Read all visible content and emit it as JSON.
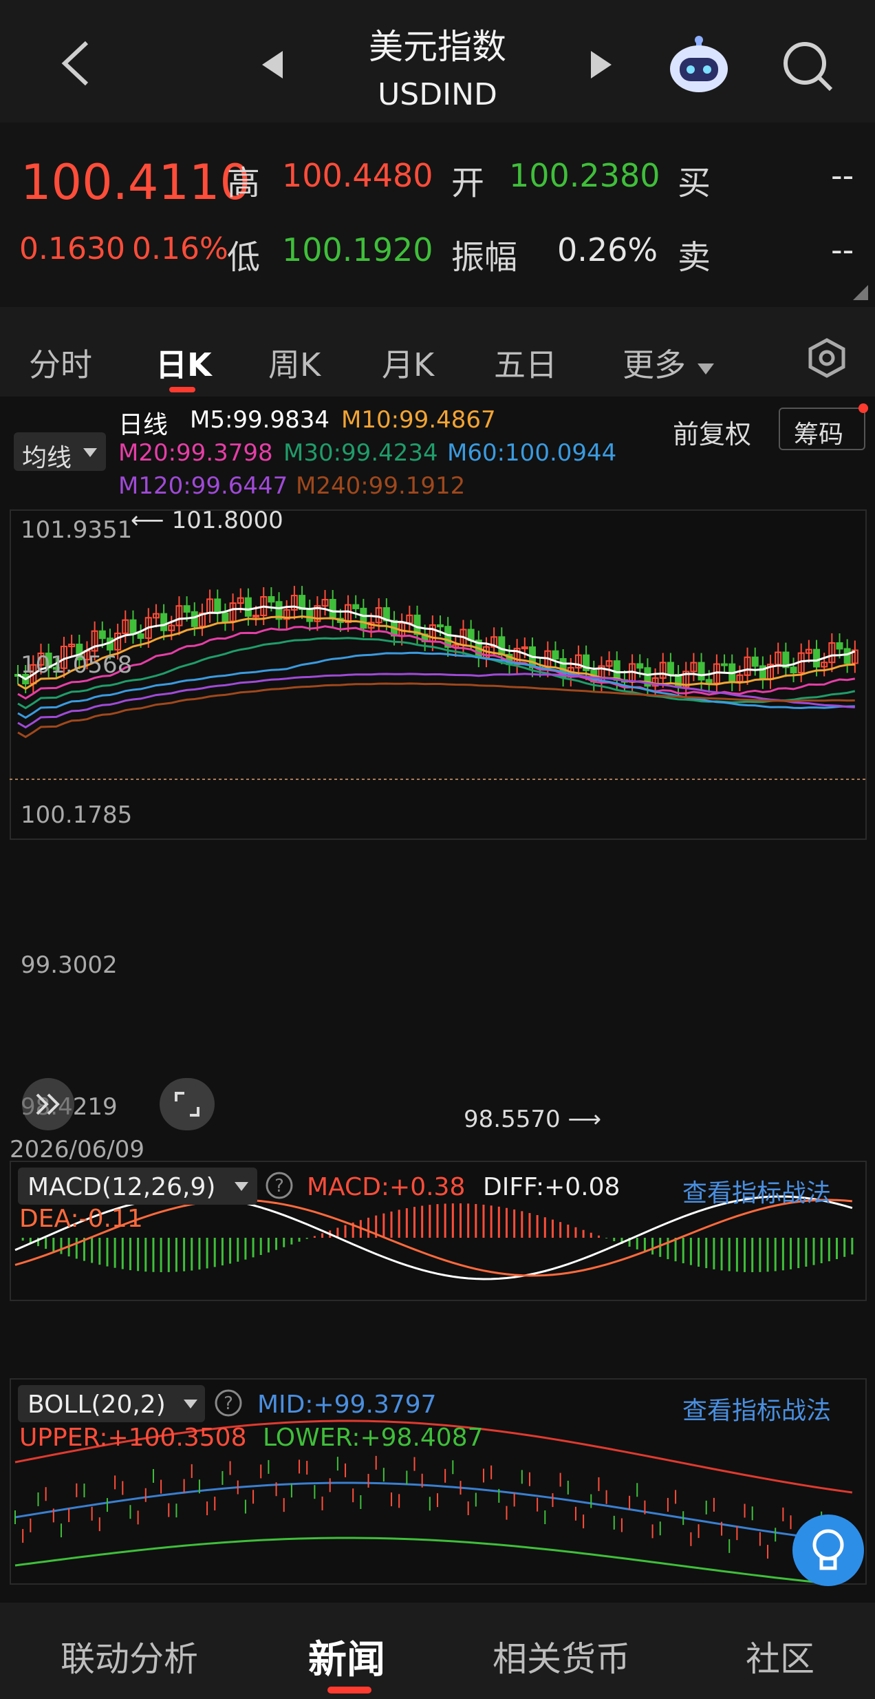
{
  "header": {
    "title": "美元指数",
    "code": "USDIND"
  },
  "quote": {
    "price": "100.4110",
    "change": "0.1630",
    "change_pct": "0.16%",
    "high_label": "高",
    "high": "100.4480",
    "open_label": "开",
    "open": "100.2380",
    "buy_label": "买",
    "buy": "--",
    "low_label": "低",
    "low": "100.1920",
    "amp_label": "振幅",
    "amp": "0.26%",
    "sell_label": "卖",
    "sell": "--"
  },
  "tabs": [
    {
      "label": "分时"
    },
    {
      "label": "日K"
    },
    {
      "label": "周K"
    },
    {
      "label": "月K"
    },
    {
      "label": "五日"
    },
    {
      "label": "更多"
    }
  ],
  "ma": {
    "toggle": "均线",
    "kline_label": "日线",
    "fq": "前复权",
    "chip": "筹码",
    "items": [
      {
        "text": "M5:99.9834",
        "color": "#ffffff"
      },
      {
        "text": "M10:99.4867",
        "color": "#f3a534"
      },
      {
        "text": "M20:99.3798",
        "color": "#e63ea6"
      },
      {
        "text": "M30:99.4234",
        "color": "#1f9d6a"
      },
      {
        "text": "M60:100.0944",
        "color": "#3a9be0"
      },
      {
        "text": "M120:99.6447",
        "color": "#a04ad8"
      },
      {
        "text": "M240:99.1912",
        "color": "#a0481c"
      }
    ]
  },
  "price_axis": [
    "101.9351",
    "101.0568",
    "100.1785",
    "99.3002",
    "98.4219"
  ],
  "annotations": {
    "high": "101.8000",
    "low": "98.5570"
  },
  "date_label": "2026/06/09",
  "macd": {
    "name": "MACD(12,26,9)",
    "macd": "MACD:+0.38",
    "diff": "DIFF:+0.08",
    "dea": "DEA:-0.11",
    "link": "查看指标战法"
  },
  "boll": {
    "name": "BOLL(20,2)",
    "mid": "MID:+99.3797",
    "upper": "UPPER:+100.3508",
    "lower": "LOWER:+98.4087",
    "link": "查看指标战法"
  },
  "nav": [
    {
      "label": "联动分析"
    },
    {
      "label": "新闻"
    },
    {
      "label": "相关货币"
    },
    {
      "label": "社区"
    }
  ]
}
